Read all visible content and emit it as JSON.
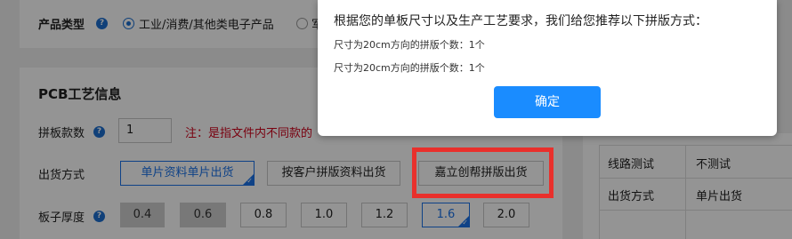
{
  "product_type": {
    "label": "产品类型",
    "help": "?",
    "option1": "工业/消费/其他类电子产品",
    "option2_partial": "军"
  },
  "pcb_section": {
    "title": "PCB工艺信息",
    "panel_count": {
      "label": "拼板款数",
      "help": "?",
      "value": "1",
      "note": "注：是指文件内不同款的"
    },
    "shipping": {
      "label": "出货方式",
      "options": [
        "单片资料单片出货",
        "按客户拼版资料出货",
        "嘉立创帮拼版出货"
      ]
    },
    "thickness": {
      "label": "板子厚度",
      "help": "?",
      "options": [
        "0.4",
        "0.6",
        "0.8",
        "1.0",
        "1.2",
        "1.6",
        "2.0"
      ]
    }
  },
  "summary_table": {
    "rows": [
      {
        "label": "线路测试",
        "value": "不测试"
      },
      {
        "label": "出货方式",
        "value": "单片出货"
      }
    ]
  },
  "modal": {
    "title": "根据您的单板尺寸以及生产工艺要求，我们给您推荐以下拼版方式：",
    "line1": "尺寸为20cm方向的拼版个数：1个",
    "line2": "尺寸为20cm方向的拼版个数：1个",
    "confirm": "确定"
  },
  "colors": {
    "accent": "#1a73e8",
    "confirm_button": "#1a8cff",
    "highlight": "#e9302c",
    "note_red": "#d0021b"
  }
}
